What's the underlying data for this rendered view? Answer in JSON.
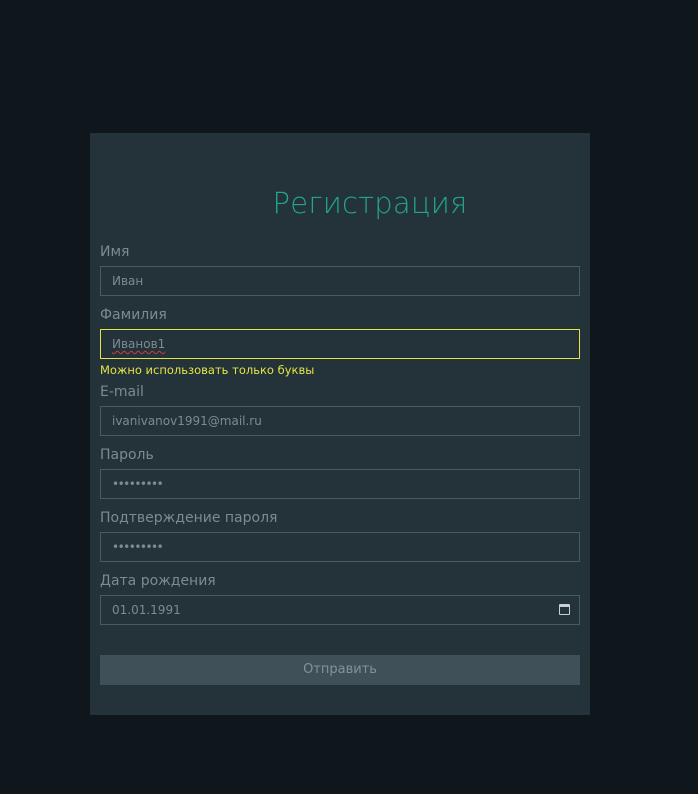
{
  "form": {
    "title": "Регистрация",
    "first_name": {
      "label": "Имя",
      "value": "Иван"
    },
    "last_name": {
      "label": "Фамилия",
      "value": "Иванов1",
      "error": "Можно использовать только буквы"
    },
    "email": {
      "label": "E-mail",
      "value": "ivanivanov1991@mail.ru"
    },
    "password": {
      "label": "Пароль",
      "value": "•••••••••"
    },
    "password_confirm": {
      "label": "Подтверждение пароля",
      "value": "•••••••••"
    },
    "birth_date": {
      "label": "Дата рождения",
      "value": "01.01.1991",
      "icon": "calendar-icon"
    },
    "submit_label": "Отправить"
  },
  "colors": {
    "page_background": "#0f161c",
    "card_background": "#24323a",
    "title": "#22a589",
    "error": "#e4e446",
    "button_background": "#3f5058"
  }
}
